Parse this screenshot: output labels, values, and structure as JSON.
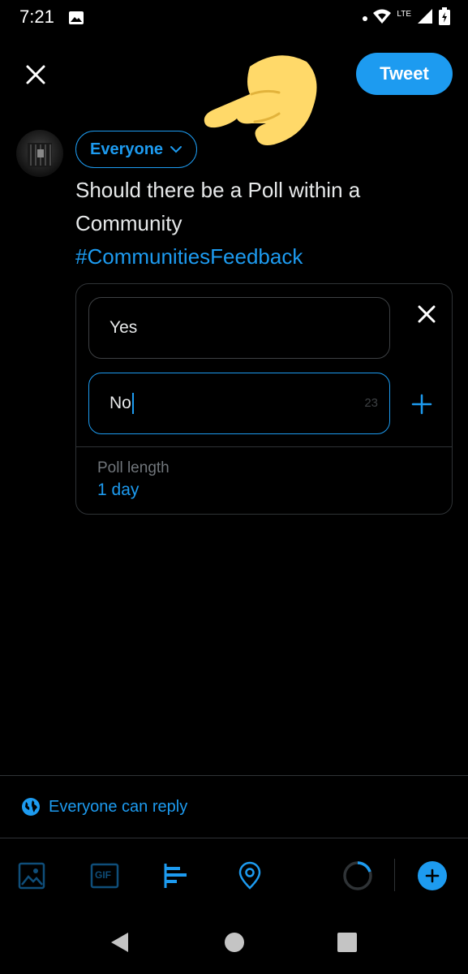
{
  "status_bar": {
    "time": "7:21",
    "network": "LTE",
    "icons": [
      "image-icon",
      "wifi-icon",
      "signal-icon",
      "battery-icon"
    ]
  },
  "header": {
    "close_icon": "close-icon",
    "tweet_label": "Tweet"
  },
  "composer": {
    "audience_label": "Everyone",
    "text": "Should there be a Poll within a Community",
    "hashtag": "#CommunitiesFeedback"
  },
  "poll": {
    "choices": [
      {
        "value": "Yes"
      },
      {
        "value": "No",
        "char_count": "23"
      }
    ],
    "length_label": "Poll length",
    "length_value": "1 day"
  },
  "reply_setting": {
    "label": "Everyone can reply",
    "icon": "globe-icon"
  },
  "toolbar": {
    "icons": [
      "image-icon",
      "gif-icon",
      "poll-icon",
      "location-icon",
      "progress-ring-icon",
      "add-thread-icon"
    ],
    "gif_label": "GIF"
  },
  "nav_bar": {
    "icons": [
      "back-icon",
      "home-icon",
      "recents-icon"
    ]
  },
  "colors": {
    "accent": "#1d9bf0",
    "background": "#000000",
    "border": "#2f3336",
    "muted": "#71767b"
  }
}
